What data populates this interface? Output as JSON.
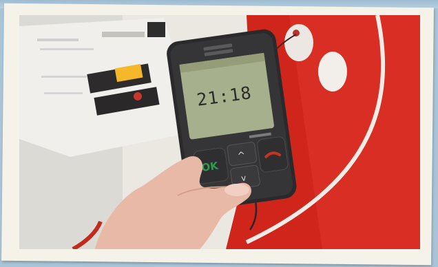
{
  "image": {
    "subject": "hand-held-mobile-phone-photo",
    "phone_screen": {
      "time": "21:18"
    },
    "phone_keys": {
      "ok_label": "OK",
      "up_symbol": "^",
      "down_symbol": "v"
    },
    "colors": {
      "frame": "#f5f2ea",
      "background_blue": "#a9c4d6",
      "red_wall": "#d0261c",
      "phone_body": "#2a2a2c",
      "screen_bg": "#a7b08c",
      "call_green": "#2e9c4a",
      "end_red": "#c63224"
    }
  }
}
